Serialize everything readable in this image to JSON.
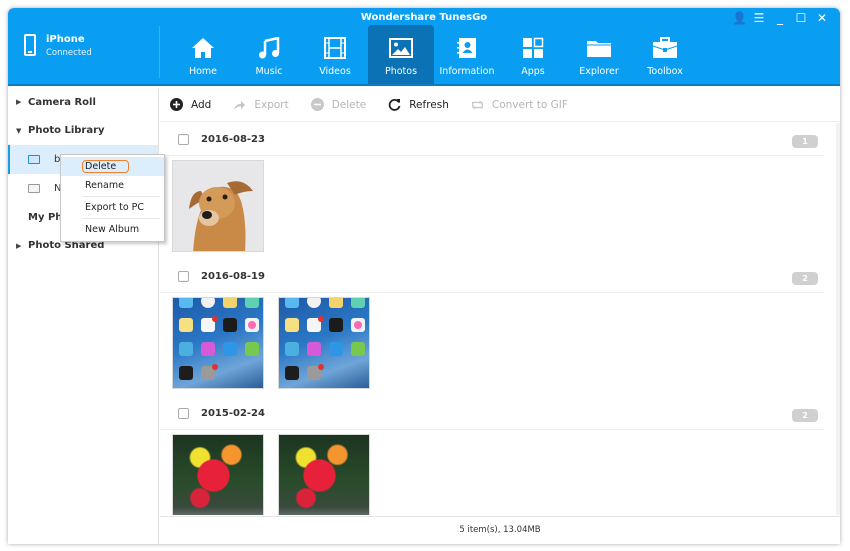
{
  "app": {
    "title": "Wondershare TunesGo",
    "window_controls": [
      "user-icon",
      "menu-icon",
      "minimize-icon",
      "maximize-icon",
      "close-icon"
    ]
  },
  "device": {
    "name": "iPhone",
    "status": "Connected"
  },
  "nav": {
    "active": "Photos",
    "items": [
      {
        "label": "Home",
        "icon": "home-icon"
      },
      {
        "label": "Music",
        "icon": "music-icon"
      },
      {
        "label": "Videos",
        "icon": "film-icon"
      },
      {
        "label": "Photos",
        "icon": "photo-icon"
      },
      {
        "label": "Information",
        "icon": "contacts-icon"
      },
      {
        "label": "Apps",
        "icon": "apps-icon"
      },
      {
        "label": "Explorer",
        "icon": "folder-icon"
      },
      {
        "label": "Toolbox",
        "icon": "toolbox-icon"
      }
    ]
  },
  "sidebar": {
    "camera_roll": "Camera Roll",
    "photo_library": "Photo Library",
    "albums": [
      {
        "label": "b",
        "selected": true
      },
      {
        "label": "N",
        "selected": false
      }
    ],
    "my_photos": "My Pho",
    "photo_shared": "Photo Shared"
  },
  "context_menu": {
    "items": [
      "Delete",
      "Rename",
      "Export to PC",
      "New Album"
    ],
    "highlighted": "Delete"
  },
  "toolbar": {
    "add": "Add",
    "export": "Export",
    "delete": "Delete",
    "refresh": "Refresh",
    "convert": "Convert to GIF"
  },
  "groups": [
    {
      "date": "2016-08-23",
      "count": "1",
      "photos": [
        "dog"
      ]
    },
    {
      "date": "2016-08-19",
      "count": "2",
      "photos": [
        "ios-homescreen",
        "ios-homescreen"
      ]
    },
    {
      "date": "2015-02-24",
      "count": "2",
      "photos": [
        "flowers",
        "flowers"
      ]
    }
  ],
  "status": {
    "summary": "5 item(s), 13.04MB"
  },
  "colors": {
    "header_bg": "#0a9ef2",
    "nav_active": "#0a72b5",
    "selection": "#dcedfb",
    "highlight_outline": "#f08030"
  }
}
